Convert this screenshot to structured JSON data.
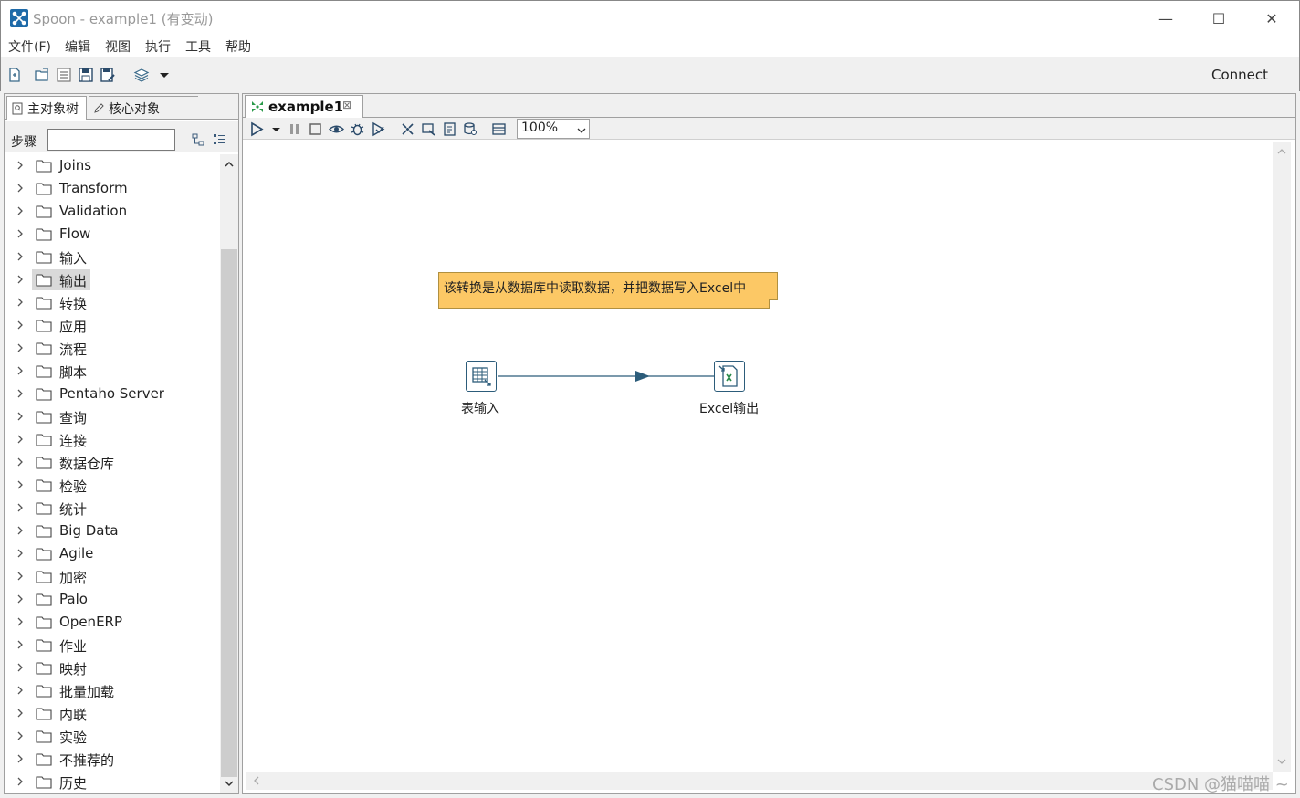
{
  "window": {
    "title": "Spoon - example1 (有变动)",
    "controls": {
      "minimize": "—",
      "maximize": "☐",
      "close": "✕"
    }
  },
  "menu": [
    "文件(F)",
    "编辑",
    "视图",
    "执行",
    "工具",
    "帮助"
  ],
  "toolbar": {
    "icons": [
      "new-file-icon",
      "open-file-icon",
      "explore-repo-icon",
      "save-icon",
      "save-as-icon",
      "perspective-icon"
    ],
    "connect_label": "Connect"
  },
  "left_panel": {
    "tabs": [
      "主对象树",
      "核心对象"
    ],
    "steps_label": "步骤",
    "search_value": "",
    "tree_items": [
      "Joins",
      "Transform",
      "Validation",
      "Flow",
      "输入",
      "输出",
      "转换",
      "应用",
      "流程",
      "脚本",
      "Pentaho Server",
      "查询",
      "连接",
      "数据仓库",
      "检验",
      "统计",
      "Big Data",
      "Agile",
      "加密",
      "Palo",
      "OpenERP",
      "作业",
      "映射",
      "批量加载",
      "内联",
      "实验",
      "不推荐的",
      "历史"
    ],
    "selected_item": "输出"
  },
  "editor": {
    "tab_label": "example1",
    "tab_close": "⊠",
    "zoom": "100%",
    "note_text": "该转换是从数据库中读取数据，并把数据写入Excel中",
    "steps": [
      {
        "label": "表输入",
        "icon": "table-input-icon"
      },
      {
        "label": "Excel输出",
        "icon": "excel-output-icon"
      }
    ]
  },
  "watermark": "CSDN @猫喵喵 ~",
  "colors": {
    "note_bg": "#fcc865",
    "hop": "#2c5c7a",
    "accent": "#1e6aa8"
  }
}
